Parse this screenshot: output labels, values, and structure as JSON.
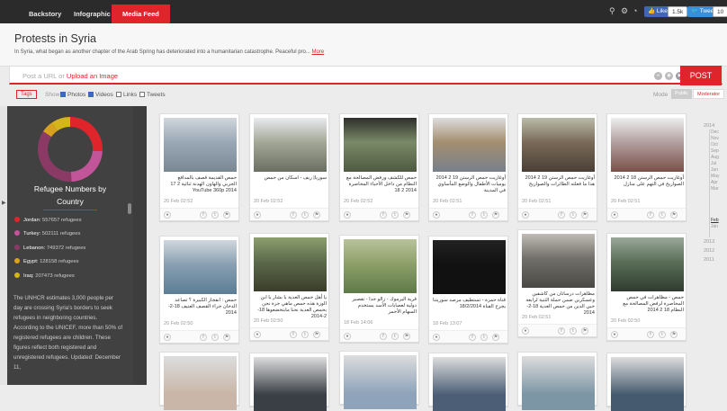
{
  "topbar": {
    "tabs": [
      {
        "label": "Backstory",
        "active": false
      },
      {
        "label": "Infographic",
        "active": false
      },
      {
        "label": "Media Feed",
        "active": true
      }
    ],
    "icons": [
      "pin-icon",
      "gear-icon",
      "rss-icon"
    ],
    "like_label": "Like",
    "like_count": "1.5k",
    "tweet_label": "Tweet",
    "tweet_count": "10"
  },
  "header": {
    "title": "Protests in Syria",
    "description": "In Syria, what began as another chapter of the Arab Spring has deteriorated into a humanitarian catastrophe. Peaceful pro...",
    "more_label": "More"
  },
  "post": {
    "placeholder_prefix": "Post a URL or",
    "upload_label": "Upload an Image",
    "button": "POST"
  },
  "filters": {
    "tags_label": "Tags",
    "show_label": "Show",
    "photos": "Photos",
    "videos": "Videos",
    "links": "Links",
    "tweets": "Tweets",
    "mode_label": "Mode",
    "mode_public": "Public",
    "mode_moderator": "Moderator"
  },
  "sidebar": {
    "title_line1": "Refugee Numbers by",
    "title_line2": "Country",
    "chart_data": {
      "type": "pie",
      "categories": [
        "Jordan",
        "Turkey",
        "Lebanon",
        "Egypt",
        "Iraq"
      ],
      "values": [
        557657,
        502111,
        749372,
        128158,
        207473
      ],
      "colors": [
        "#e0242c",
        "#c2559a",
        "#8b3a66",
        "#d8a21f",
        "#d4b51a"
      ]
    },
    "rows": [
      {
        "country": "Jordan:",
        "value": "557657 refugees",
        "color": "#e0242c"
      },
      {
        "country": "Turkey:",
        "value": "502111 refugees",
        "color": "#c2559a"
      },
      {
        "country": "Lebanon:",
        "value": "749372 refugees",
        "color": "#8b3a66"
      },
      {
        "country": "Egypt:",
        "value": "128158 refugees",
        "color": "#d8a21f"
      },
      {
        "country": "Iraq:",
        "value": "207473 refugees",
        "color": "#d4b51a"
      }
    ],
    "text": "The UNHCR estimates 3,000 people per day are crossing Syria's borders to seek refugees in neighboring countries. According to the UNICEF, more than 50% of registered refugees are children. These figures reflect both registered and unregistered refugees. Updated: December 11,"
  },
  "cards": [
    {
      "text": "حمص القديمة قصف بالمدافع الحربي والهاون الهدنة ثنائية 2 17 2014 YouTube 360p",
      "date": "20 Feb 02:52"
    },
    {
      "text": "سوريا| ريف - اسكان من حمص",
      "date": "20 Feb 02:52"
    },
    {
      "text": "حمص للكشف ورفض المصالحة مع النظام من داخل الأحياء المحاصرة 2014 2 18",
      "date": "20 Feb 02:52"
    },
    {
      "text": "أوغاريت حمص الرستن 19 2 2014 يوميات الأطفال والوضع المأساوي في المدينة",
      "date": "20 Feb 02:51"
    },
    {
      "text": "أوغاريت حمص الرستن 19 2 2014 هذا ما فعلته الطائرات والصواريخ",
      "date": "20 Feb 02:51"
    },
    {
      "text": "أوغاريت حمص الرستن 18 2 2014 الصواريخ في التهم على منازل",
      "date": "20 Feb 02:51"
    },
    {
      "text": "حمص : انفجار الكبيرة ؟ تصاعد الدخان جراء القصف العنيف 18-2-2014",
      "date": "20 Feb 02:50"
    },
    {
      "text": "يا أهل حمص العدية يا بشار يا ابن الوزة هذه حمص ماهي جرة نحن بحمص العدية نحنا مابتخضعوها 18-2-2014",
      "date": "20 Feb 02:50"
    },
    {
      "text": "قرية اليرموك - زالو جدا - تقصير دولية لعصابات الأسد يستخدم السهام الأحمر",
      "date": "18 Feb 14:06"
    },
    {
      "text": "قناة حمزة - تستطيف مرصد سوريتنا يجرح القناة 18/2/2014",
      "date": "18 Feb 13:07"
    },
    {
      "text": "مظاهرات درساتان من كاشفين وعسكرين ضمن حملة الثنية لرابعة حيي الدين من حمص العدية 18-2-2014",
      "date": "20 Feb 02:51"
    },
    {
      "text": "حمص - مظاهرات في حمص المحاصرة لرفض المصالحة مع النظام 18 2 2014",
      "date": "20 Feb 02:50"
    }
  ],
  "timeline": {
    "items": [
      "2014",
      "Dec",
      "Nov",
      "Oct",
      "Sep",
      "Aug",
      "Jul",
      "Jun",
      "May",
      "Apr",
      "Mar",
      "Feb",
      "Jan",
      "2013",
      "2012",
      "2011"
    ],
    "current": "Feb"
  },
  "colors": {
    "accent": "#e0242c",
    "topbar": "#2b2b2b",
    "sidebar": "#414141"
  }
}
